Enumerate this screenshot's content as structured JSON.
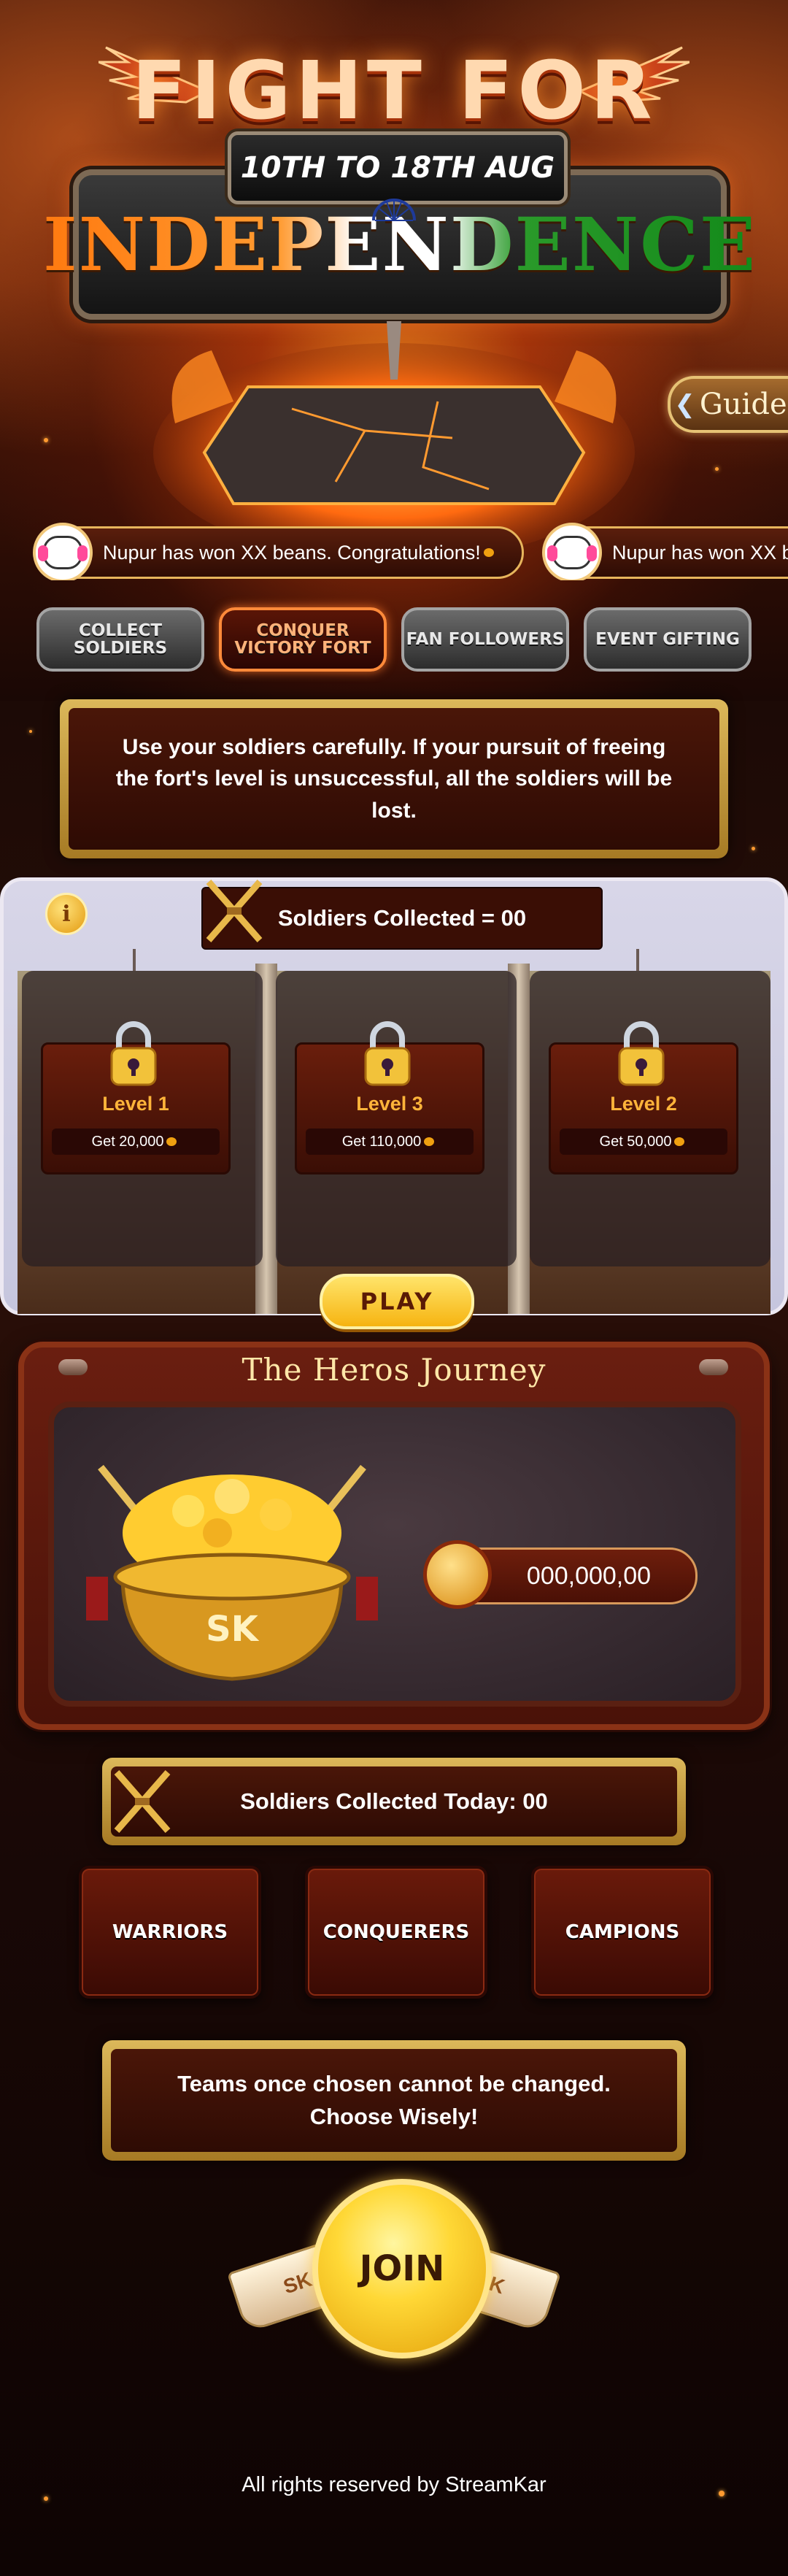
{
  "header": {
    "title_line1": "FIGHT FOR",
    "date_range": "10TH TO 18TH AUG",
    "title_line2": "INDEPENDENCE",
    "guide_label": "Guide"
  },
  "ticker": {
    "messages": [
      "Nupur has won XX beans. Congratulations!",
      "Nupur has won XX b"
    ]
  },
  "tabs": [
    {
      "label": "COLLECT SOLDIERS",
      "active": false
    },
    {
      "label": "CONQUER VICTORY FORT",
      "active": true
    },
    {
      "label": "FAN FOLLOWERS",
      "active": false
    },
    {
      "label": "EVENT GIFTING",
      "active": false
    }
  ],
  "warning_text": "Use your soldiers carefully. If your pursuit of freeing the fort's level is unsuccessful, all the soldiers will be lost.",
  "fort": {
    "info_icon": "i",
    "soldiers_collected": "Soldiers Collected = 00",
    "levels": [
      {
        "name": "Level 1",
        "reward": "Get 20,000"
      },
      {
        "name": "Level 3",
        "reward": "Get 110,000"
      },
      {
        "name": "Level 2",
        "reward": "Get 50,000"
      }
    ],
    "play_label": "PLAY"
  },
  "journey": {
    "title": "The Heros Journey",
    "pot_label": "SK",
    "coin_value": "000,000,00"
  },
  "soldiers_today": "Soldiers Collected Today: 00",
  "teams": [
    "WARRIORS",
    "CONQUERERS",
    "CAMPIONS"
  ],
  "team_warning": "Teams once chosen cannot be changed. Choose Wisely!",
  "join": {
    "label": "JOIN",
    "ribbon_left": "SK",
    "ribbon_right": "SK"
  },
  "footer": "All rights reserved by StreamKar",
  "colors": {
    "accent_gold": "#dcb85a",
    "panel_maroon": "#4a1608",
    "active_tab": "#ff8a3a",
    "level_text": "#ffb43a"
  }
}
